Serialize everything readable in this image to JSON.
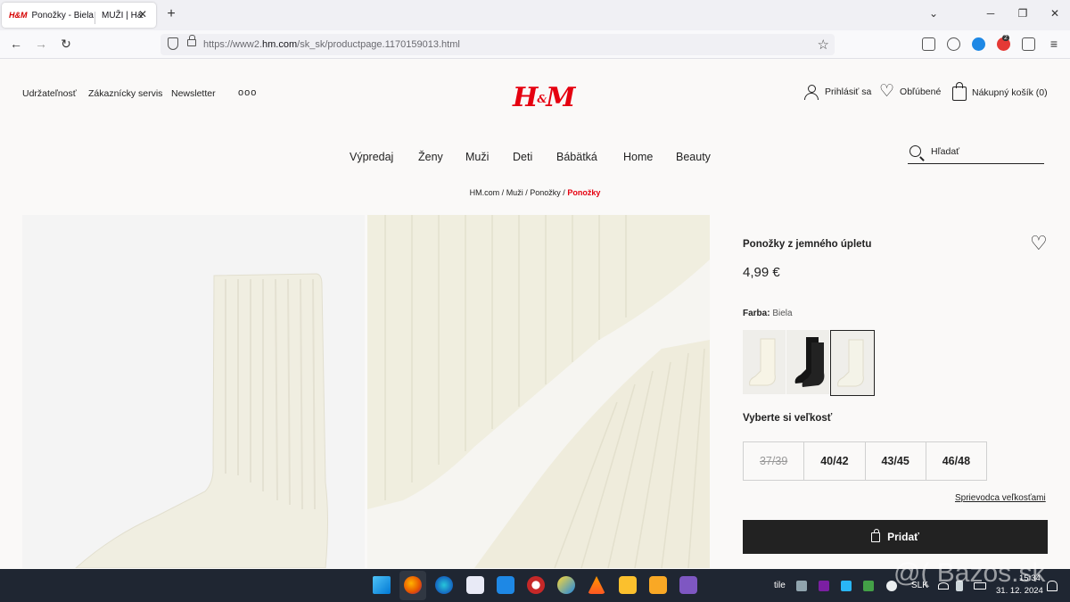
{
  "browser": {
    "tabs": [
      {
        "favicon": "H&M",
        "title": "Ponožky - Biela"
      },
      {
        "title": "MUŽI | H&"
      }
    ],
    "new_tab_icon": "plus-icon",
    "url_prefix": "https://www2.",
    "url_domain": "hm.com",
    "url_path": "/sk_sk/productpage.1170159013.html",
    "extension_badge": "2"
  },
  "header": {
    "util_links": [
      "Udržateľnosť",
      "Zákaznícky servis",
      "Newsletter"
    ],
    "more": "ooo",
    "logo": "H&M",
    "account": {
      "login": "Prihlásiť sa",
      "favorites": "Obľúbené",
      "cart": "Nákupný košík (0)"
    }
  },
  "nav": {
    "items": [
      "Výpredaj",
      "Ženy",
      "Muži",
      "Deti",
      "Bábätká",
      "Home",
      "Beauty"
    ],
    "search_placeholder": "Hľadať"
  },
  "breadcrumb": {
    "items": [
      "HM.com",
      "Muži",
      "Ponožky"
    ],
    "current": "Ponožky",
    "separator": "/"
  },
  "product": {
    "title": "Ponožky z jemného úpletu",
    "price": "4,99 €",
    "color_label": "Farba:",
    "color_value": "Biela",
    "swatches": [
      {
        "name": "cream",
        "color": "#f0ede0"
      },
      {
        "name": "black",
        "color": "#151515"
      },
      {
        "name": "white",
        "color": "#efeee4",
        "selected": true
      }
    ],
    "size_label": "Vyberte si veľkosť",
    "sizes": [
      {
        "label": "37/39",
        "available": false
      },
      {
        "label": "40/42",
        "available": true
      },
      {
        "label": "43/45",
        "available": true
      },
      {
        "label": "46/48",
        "available": true
      }
    ],
    "size_guide": "Sprievodca veľkosťami",
    "add_button": "Pridať"
  },
  "taskbar": {
    "weather": "tile",
    "language": "SLK",
    "time": "15:34",
    "date": "31. 12. 2024",
    "watermark": "@( Bazos.sk"
  },
  "colors": {
    "brand_red": "#e50010",
    "button_dark": "#222222",
    "taskbar": "#1f2632",
    "page_bg": "#faf9f8"
  }
}
